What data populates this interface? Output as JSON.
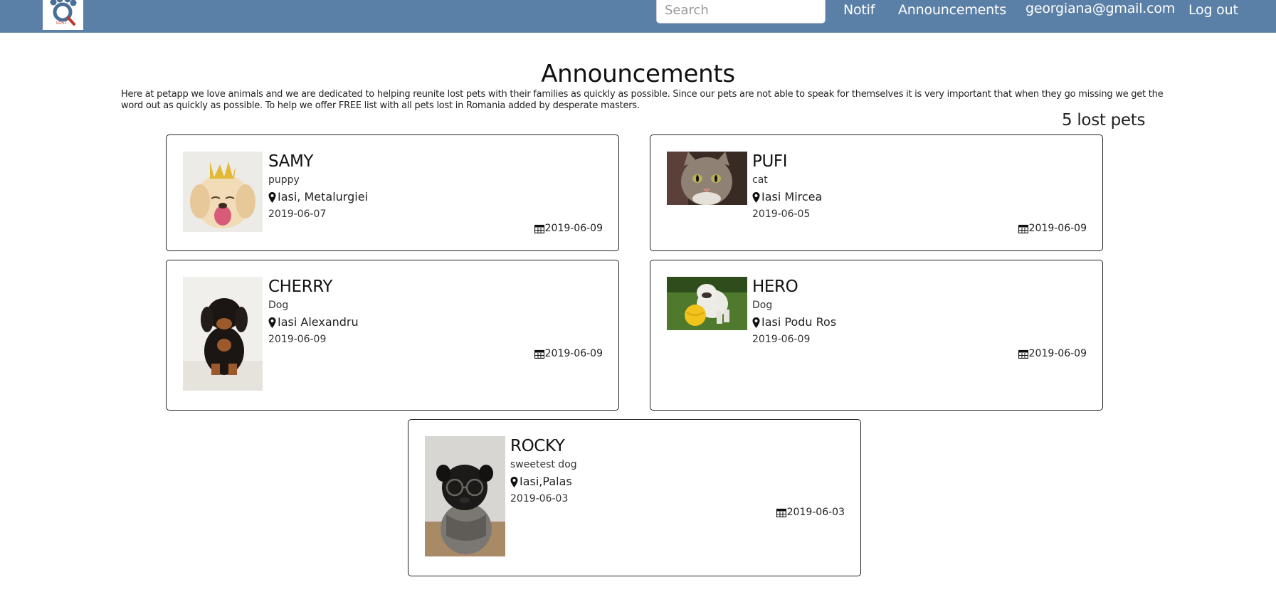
{
  "nav": {
    "logo_text": "LOST",
    "search_placeholder": "Search",
    "links": [
      "Notif",
      "Announcements",
      "georgiana@gmail.com",
      "Log out"
    ]
  },
  "page": {
    "title": "Announcements",
    "intro": "Here at petapp we love animals and we are dedicated to helping reunite lost pets with their families as quickly as possible. Since our pets are not able to speak for themselves it is very important that when they go missing we get the word out as quickly as possible. To help we offer FREE list with all pets lost in Romania added by desperate masters.",
    "count": "5 lost pets"
  },
  "pets": [
    {
      "name": "SAMY",
      "type": "puppy",
      "location": "Iasi, Metalurgiei",
      "lost_date": "2019-06-07",
      "posted_date": "2019-06-09",
      "photo": "golden-puppy-crown-photo"
    },
    {
      "name": "PUFI",
      "type": "cat",
      "location": "Iasi Mircea",
      "lost_date": "2019-06-05",
      "posted_date": "2019-06-09",
      "photo": "tabby-cat-photo"
    },
    {
      "name": "CHERRY",
      "type": "Dog",
      "location": "Iasi Alexandru",
      "lost_date": "2019-06-09",
      "posted_date": "2019-06-09",
      "photo": "dachshund-puppy-photo"
    },
    {
      "name": "HERO",
      "type": "Dog",
      "location": "Iasi Podu Ros",
      "lost_date": "2019-06-09",
      "posted_date": "2019-06-09",
      "photo": "bulldog-ball-photo"
    },
    {
      "name": "ROCKY",
      "type": "sweetest dog",
      "location": "Iasi,Palas",
      "lost_date": "2019-06-03",
      "posted_date": "2019-06-03",
      "photo": "pug-glasses-photo"
    }
  ],
  "icons": {
    "pin": "map-pin-icon",
    "calendar": "calendar-icon"
  },
  "colors": {
    "navbar": "#5b80a7",
    "nav_text": "#ffffff"
  }
}
